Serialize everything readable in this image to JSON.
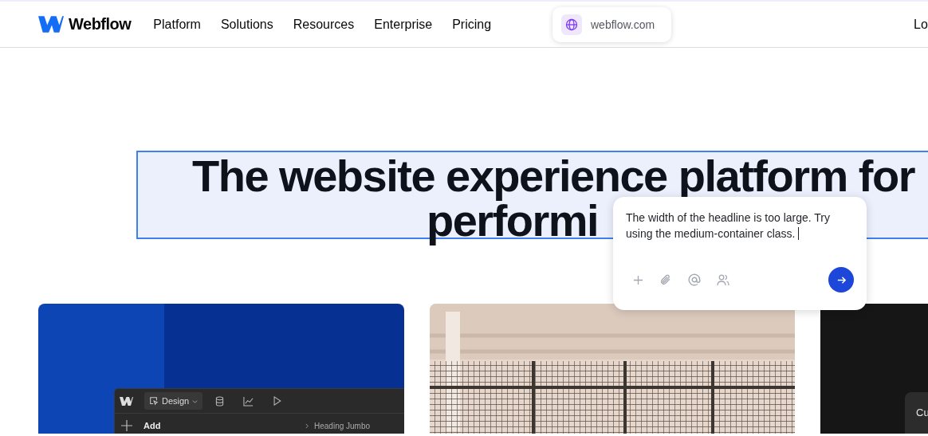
{
  "nav": {
    "brand": "Webflow",
    "links": [
      "Platform",
      "Solutions",
      "Resources",
      "Enterprise",
      "Pricing"
    ],
    "url_pill": "webflow.com",
    "cut_link": "Lo"
  },
  "headline": {
    "selected": true,
    "lines": [
      "The website experience platform for",
      "performi"
    ]
  },
  "comment": {
    "text": "The width of the headline is too large. Try using the medium-container class."
  },
  "cards": [
    {
      "kind": "designer",
      "mode": "Design",
      "panel_title": "Add",
      "breadcrumb": "Heading Jumbo"
    },
    {
      "kind": "picture"
    },
    {
      "kind": "dark",
      "panel_label": "Cu"
    }
  ]
}
